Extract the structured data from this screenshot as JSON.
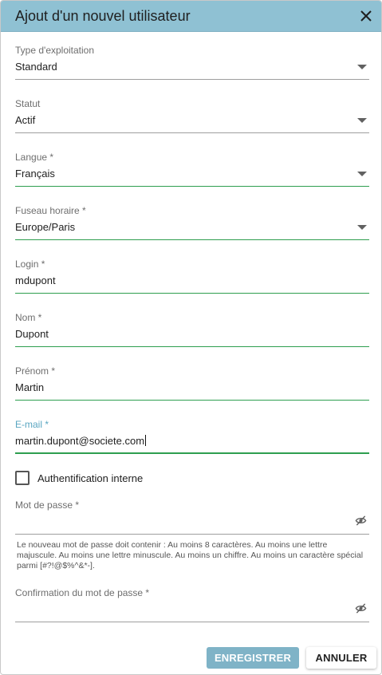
{
  "dialog": {
    "title": "Ajout d'un nouvel utilisateur",
    "close_icon": "close-icon"
  },
  "fields": {
    "operating_type": {
      "label": "Type d'exploitation",
      "value": "Standard"
    },
    "status": {
      "label": "Statut",
      "value": "Actif"
    },
    "language": {
      "label": "Langue *",
      "value": "Français"
    },
    "timezone": {
      "label": "Fuseau horaire *",
      "value": "Europe/Paris"
    },
    "login": {
      "label": "Login *",
      "value": "mdupont"
    },
    "last_name": {
      "label": "Nom *",
      "value": "Dupont"
    },
    "first_name": {
      "label": "Prénom *",
      "value": "Martin"
    },
    "email": {
      "label": "E-mail *",
      "value": "martin.dupont@societe.com"
    },
    "internal_auth": {
      "label": "Authentification interne",
      "checked": false
    },
    "password": {
      "label": "Mot de passe *",
      "value": "",
      "toggle_icon": "eye-off-icon"
    },
    "password_help": "Le nouveau mot de passe doit contenir : Au moins 8 caractères. Au moins une lettre majuscule. Au moins une lettre minuscule. Au moins un chiffre. Au moins un caractère spécial parmi [#?!@$%^&*-].",
    "password_confirm": {
      "label": "Confirmation du mot de passe *",
      "value": "",
      "toggle_icon": "eye-off-icon"
    }
  },
  "buttons": {
    "save": "ENREGISTRER",
    "cancel": "ANNULER"
  },
  "colors": {
    "header_bg": "#8fc1d3",
    "valid_line": "#2e9e4f",
    "focus_label": "#5aa6c1",
    "save_button": "#7fb3c7"
  }
}
